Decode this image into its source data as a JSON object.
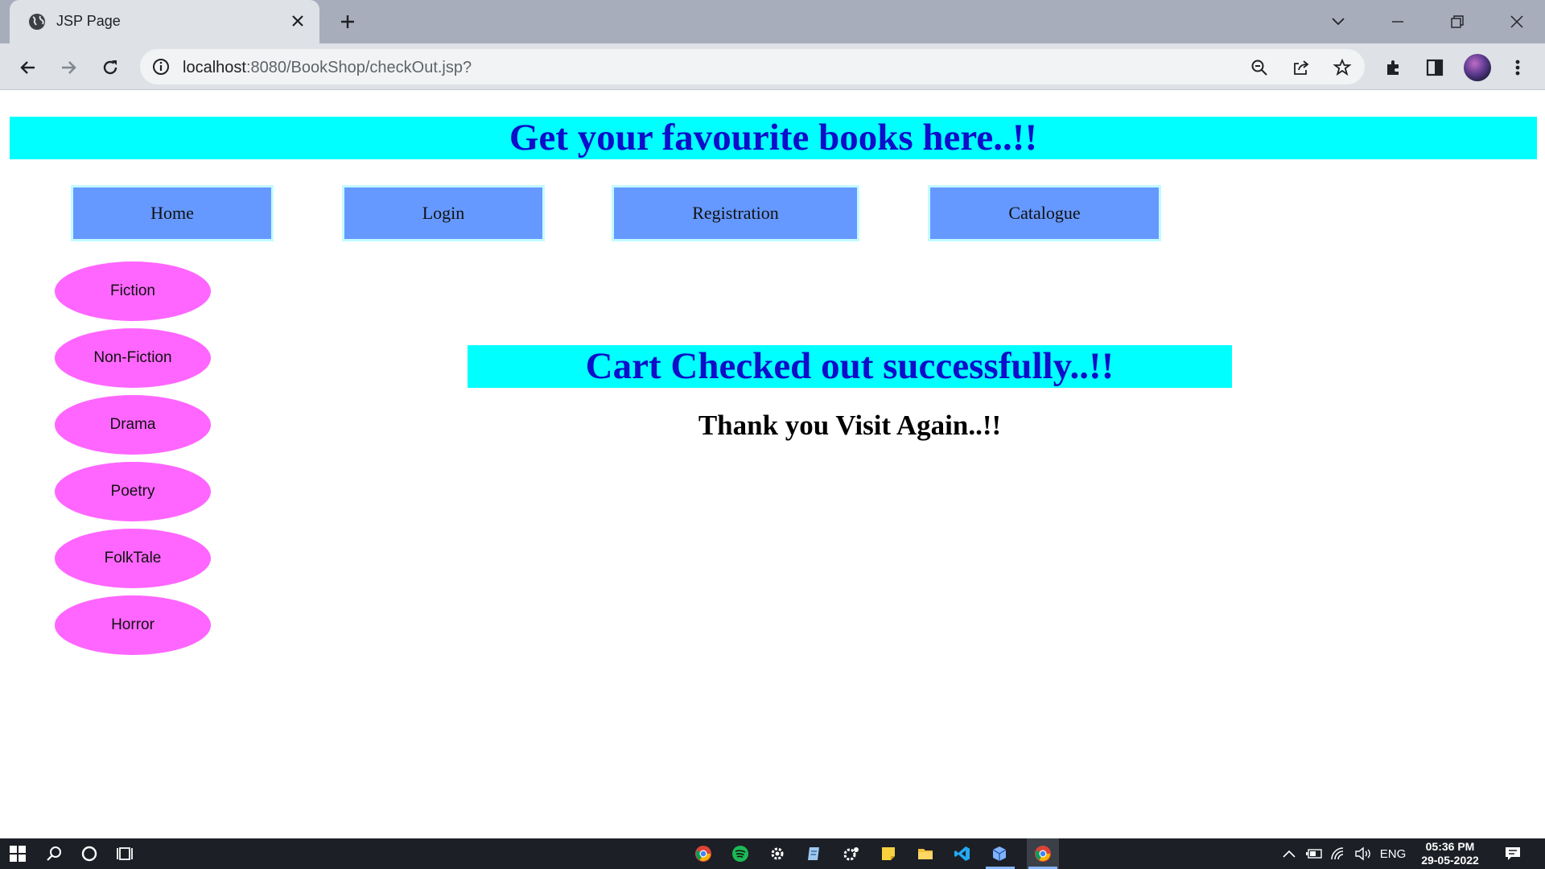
{
  "browser": {
    "tab_title": "JSP Page",
    "url_host": "localhost",
    "url_rest": ":8080/BookShop/checkOut.jsp?"
  },
  "page": {
    "banner": "Get your favourite books here..!!",
    "nav": [
      "Home",
      "Login",
      "Registration",
      "Catalogue"
    ],
    "categories": [
      "Fiction",
      "Non-Fiction",
      "Drama",
      "Poetry",
      "FolkTale",
      "Horror"
    ],
    "success_message": "Cart Checked out successfully..!!",
    "thanks_message": "Thank you Visit Again..!!"
  },
  "taskbar": {
    "language": "ENG",
    "time": "05:36 PM",
    "date": "29-05-2022"
  },
  "colors": {
    "banner_bg": "#00ffff",
    "banner_text": "#0d0ec9",
    "nav_bg": "#6699ff",
    "category_bg": "#ff66ff"
  }
}
